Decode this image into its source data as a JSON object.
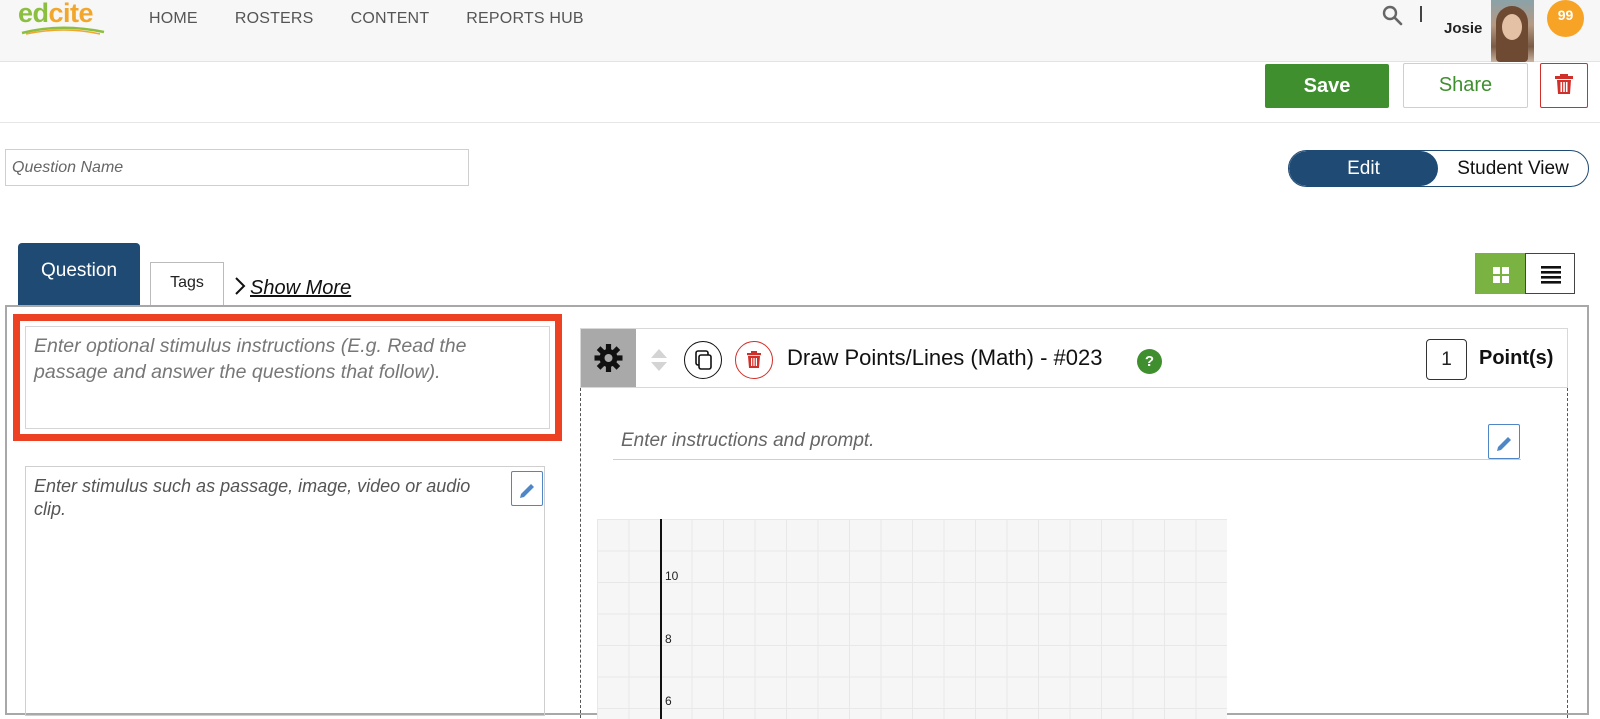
{
  "app": {
    "logo": {
      "part1": "ed",
      "part2": "cite"
    },
    "nav": [
      "HOME",
      "ROSTERS",
      "CONTENT",
      "REPORTS HUB"
    ],
    "user": {
      "name": "Josie",
      "notifications": "99"
    }
  },
  "toolbar": {
    "save_label": "Save",
    "share_label": "Share"
  },
  "question_name": {
    "placeholder": "Question Name"
  },
  "mode_toggle": {
    "active": "Edit",
    "inactive": "Student View"
  },
  "tabs": {
    "question": "Question",
    "tags": "Tags",
    "show_more": "Show More"
  },
  "stimulus": {
    "instructions_placeholder": "Enter optional stimulus instructions (E.g. Read the passage and answer the questions that follow).",
    "content_placeholder": "Enter stimulus such as passage, image, video or audio clip."
  },
  "question_card": {
    "title": "Draw Points/Lines (Math) - #023",
    "help": "?",
    "points_value": "1",
    "points_label": "Point(s)",
    "prompt_placeholder": "Enter instructions and prompt."
  },
  "graph": {
    "y_ticks": [
      "10",
      "8",
      "6"
    ]
  },
  "colors": {
    "primary": "#1f4a74",
    "save": "#3f8f2e",
    "delete": "#d0302a",
    "highlight": "#ec4122",
    "badge": "#f7a326"
  }
}
